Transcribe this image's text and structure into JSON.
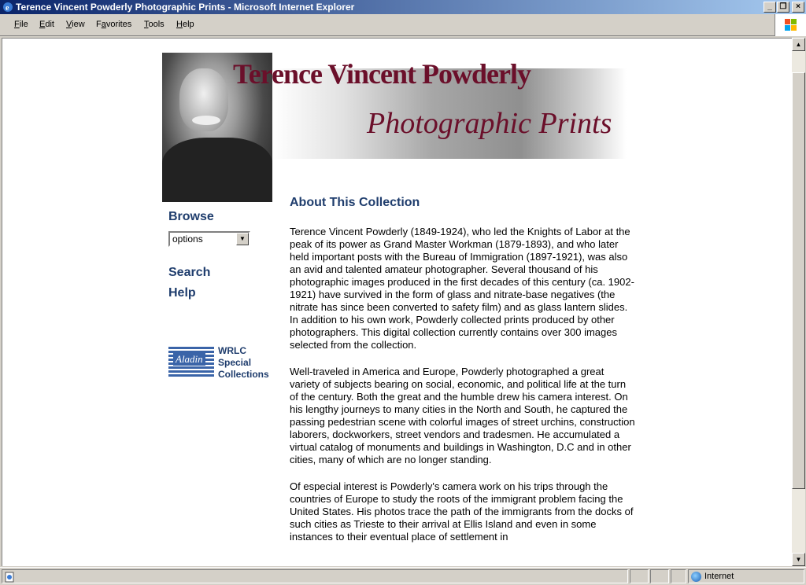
{
  "window": {
    "title": "Terence Vincent Powderly Photographic Prints - Microsoft Internet Explorer",
    "controls": [
      "_",
      "❐",
      "×"
    ]
  },
  "menu": [
    {
      "label": "File",
      "key": "F"
    },
    {
      "label": "Edit",
      "key": "E"
    },
    {
      "label": "View",
      "key": "V"
    },
    {
      "label": "Favorites",
      "key": "a"
    },
    {
      "label": "Tools",
      "key": "T"
    },
    {
      "label": "Help",
      "key": "H"
    }
  ],
  "banner": {
    "title": "Terence Vincent Powderly",
    "subtitle": "Photographic Prints"
  },
  "sidebar": {
    "browse": "Browse",
    "select_value": "options",
    "search": "Search",
    "help": "Help",
    "wrlc_script": "Aladin",
    "wrlc_text": "WRLC Special Collections"
  },
  "main": {
    "heading": "About This Collection",
    "paragraphs": [
      "Terence Vincent Powderly (1849-1924), who led the Knights of Labor at the peak of its power as Grand Master Workman (1879-1893), and who later held important posts with the Bureau of Immigration (1897-1921), was also an avid and talented amateur photographer. Several thousand of his photographic images produced in the first decades of this century (ca. 1902-1921) have survived in the form of glass and nitrate-base negatives (the nitrate has since been converted to safety film) and as glass lantern slides. In addition to his own work, Powderly collected prints produced by other photographers. This digital collection currently contains over 300 images selected from the collection.",
      "Well-traveled in America and Europe, Powderly photographed a great variety of subjects bearing on social, economic, and political life at the turn of the century. Both the great and the humble drew his camera interest. On his lengthy journeys to many cities in the North and South, he captured the passing pedestrian scene with colorful images of street urchins, construction laborers, dockworkers, street vendors and tradesmen. He accumulated a virtual catalog of monuments and buildings in Washington, D.C and in other cities, many of which are no longer standing.",
      "Of especial interest is Powderly's camera work on his trips through the countries of Europe to study the roots of the immigrant problem facing the United States. His photos trace the path of the immigrants from the docks of such cities as Trieste to their arrival at Ellis Island and even in some instances to their eventual place of settlement in"
    ]
  },
  "status": {
    "zone": "Internet"
  },
  "colors": {
    "title_gradient_start": "#0a246a",
    "banner_text": "#6b0f2a",
    "link": "#1f3d6d"
  }
}
